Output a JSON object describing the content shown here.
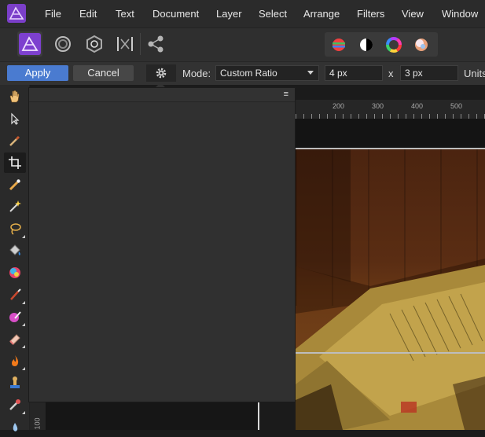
{
  "menubar": {
    "items": [
      "File",
      "Edit",
      "Text",
      "Document",
      "Layer",
      "Select",
      "Arrange",
      "Filters",
      "View",
      "Window"
    ]
  },
  "toolbar": {
    "personas": [
      "photo-persona-icon",
      "liquify-persona-icon",
      "develop-persona-icon",
      "tone-mapping-persona-icon",
      "export-persona-icon"
    ],
    "color_buttons": [
      "color-balance-icon",
      "black-white-icon",
      "color-wheel-icon",
      "color-picker-icon"
    ]
  },
  "context_bar": {
    "apply_label": "Apply",
    "cancel_label": "Cancel",
    "mode_label": "Mode:",
    "mode_value": "Custom Ratio",
    "width_value": "4 px",
    "times_label": "x",
    "height_value": "3 px",
    "units_label": "Units"
  },
  "ruler": {
    "top_ticks": [
      "200",
      "300",
      "400",
      "500"
    ],
    "left_tick": "100"
  },
  "panel": {
    "menu_glyph": "≡"
  },
  "colors": {
    "accent": "#4a7bd0",
    "logo": "#8c3fd3"
  }
}
